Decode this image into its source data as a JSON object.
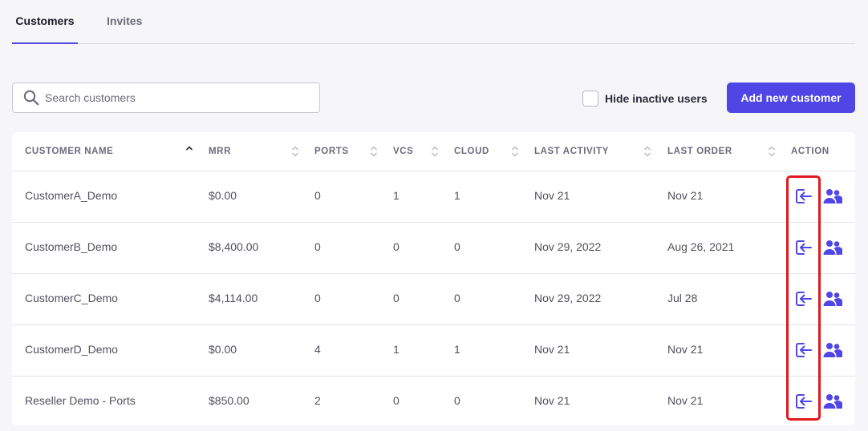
{
  "tabs": [
    {
      "label": "Customers",
      "active": true
    },
    {
      "label": "Invites",
      "active": false
    }
  ],
  "search": {
    "placeholder": "Search customers",
    "value": "",
    "icon": "search-icon"
  },
  "filter": {
    "hide_inactive_label": "Hide inactive users",
    "checked": false
  },
  "add_button": {
    "label": "Add new customer",
    "color": "#4f46e5"
  },
  "table": {
    "columns": [
      "CUSTOMER NAME",
      "MRR",
      "PORTS",
      "VCS",
      "CLOUD",
      "LAST ACTIVITY",
      "LAST ORDER",
      "ACTION"
    ],
    "sorted_column": "CUSTOMER NAME",
    "sort_direction": "ascending",
    "rows": [
      {
        "name": "CustomerA_Demo",
        "mrr": "$0.00",
        "ports": "0",
        "vcs": "1",
        "cloud": "1",
        "last_activity": "Nov 21",
        "last_order": "Nov 21"
      },
      {
        "name": "CustomerB_Demo",
        "mrr": "$8,400.00",
        "ports": "0",
        "vcs": "0",
        "cloud": "0",
        "last_activity": "Nov 29, 2022",
        "last_order": "Aug 26, 2021"
      },
      {
        "name": "CustomerC_Demo",
        "mrr": "$4,114.00",
        "ports": "0",
        "vcs": "0",
        "cloud": "0",
        "last_activity": "Nov 29, 2022",
        "last_order": "Jul 28"
      },
      {
        "name": "CustomerD_Demo",
        "mrr": "$0.00",
        "ports": "4",
        "vcs": "1",
        "cloud": "1",
        "last_activity": "Nov 21",
        "last_order": "Nov 21"
      },
      {
        "name": "Reseller Demo - Ports",
        "mrr": "$850.00",
        "ports": "2",
        "vcs": "0",
        "cloud": "0",
        "last_activity": "Nov 21",
        "last_order": "Nov 21"
      }
    ],
    "row_actions": [
      {
        "icon": "login-icon"
      },
      {
        "icon": "users-icon"
      }
    ]
  },
  "colors": {
    "accent": "#4f46e5",
    "highlight": "#e0191f"
  }
}
